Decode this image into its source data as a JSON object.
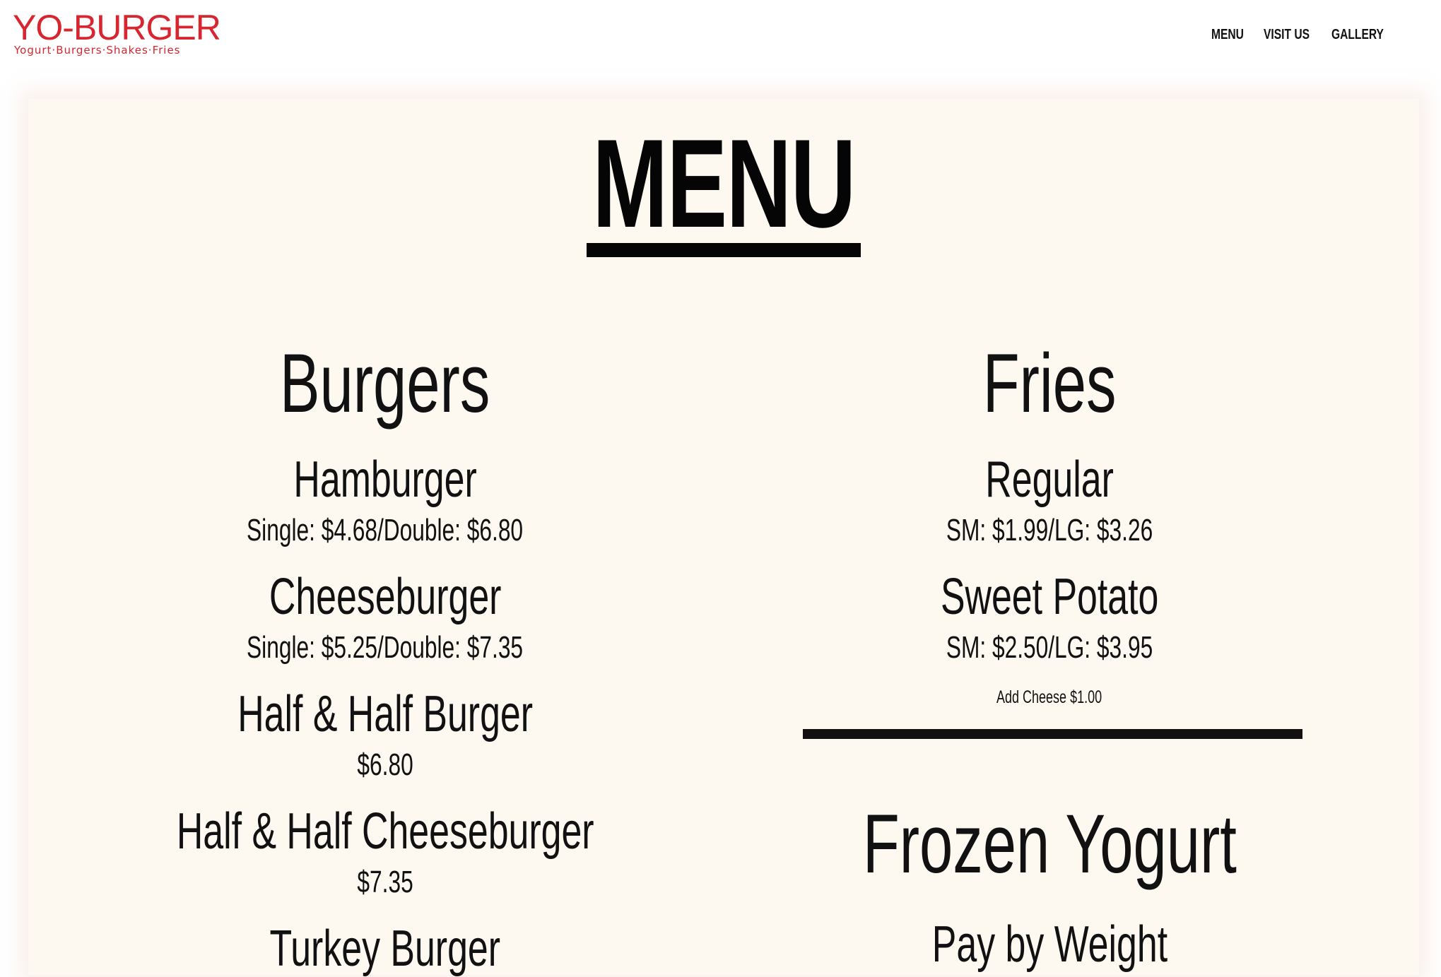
{
  "brand": {
    "logo_main": "YO-BURGER",
    "logo_tagline": "Yogurt·Burgers·Shakes·Fries",
    "accent_color": "#d82630"
  },
  "nav": {
    "items": [
      {
        "label": "MENU"
      },
      {
        "label": "VISIT US"
      },
      {
        "label": "GALLERY"
      }
    ]
  },
  "page": {
    "title": "MENU"
  },
  "burgers": {
    "title": "Burgers",
    "items": [
      {
        "name": "Hamburger",
        "price": "Single: $4.68/Double: $6.80"
      },
      {
        "name": "Cheeseburger",
        "price": "Single: $5.25/Double: $7.35"
      },
      {
        "name": "Half & Half Burger",
        "price": "$6.80"
      },
      {
        "name": "Half & Half Cheeseburger",
        "price": "$7.35"
      },
      {
        "name": "Turkey Burger",
        "price": ""
      }
    ]
  },
  "fries": {
    "title": "Fries",
    "items": [
      {
        "name": "Regular",
        "price": "SM: $1.99/LG: $3.26"
      },
      {
        "name": "Sweet Potato",
        "price": "SM: $2.50/LG: $3.95"
      }
    ],
    "note": "Add Cheese $1.00"
  },
  "frozen_yogurt": {
    "title": "Frozen Yogurt",
    "subtitle": "Pay by Weight"
  }
}
